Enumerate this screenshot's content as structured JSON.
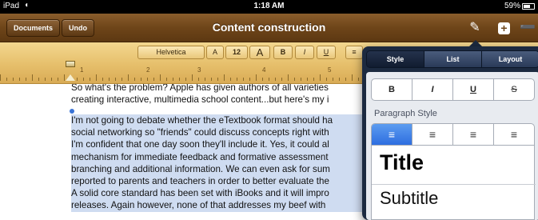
{
  "status_bar": {
    "device": "iPad",
    "time": "1:18 AM",
    "battery": "59%"
  },
  "toolbar": {
    "documents_label": "Documents",
    "undo_label": "Undo",
    "title": "Content construction"
  },
  "format_bar": {
    "font": "Helvetica",
    "smaller": "A",
    "size": "12",
    "larger": "A",
    "bold": "B",
    "italic": "I",
    "underline": "U",
    "align": "≡"
  },
  "ruler": {
    "numbers": [
      "1",
      "2",
      "3",
      "4",
      "5"
    ]
  },
  "document": {
    "para1": [
      "So what's the problem? Apple has given authors of all varieties",
      "creating interactive, multimedia school content...but here's my i"
    ],
    "para2": [
      "I'm not going to debate whether the eTextbook format should ha",
      "social networking so \"friends\" could discuss concepts right with",
      "I'm confident that one day soon they'll include it. Yes, it could al",
      "mechanism for immediate feedback and formative assessment",
      "branching and additional information. We can even ask for sum",
      "reported to parents and teachers in order to better evaluate the",
      "A solid core standard has been set with iBooks and it will impro",
      "releases. Again however, none of that addresses my beef with"
    ]
  },
  "popover": {
    "tabs": [
      "Style",
      "List",
      "Layout"
    ],
    "active_tab": "Style",
    "text_styles": [
      "B",
      "I",
      "U",
      "S"
    ],
    "paragraph_style_label": "Paragraph Style",
    "alignments": [
      "align-left",
      "align-center",
      "align-right",
      "justify"
    ],
    "styles": [
      "Title",
      "Subtitle"
    ]
  },
  "colors": {
    "selection": "#cfdcf1",
    "wood": "#6e4519",
    "popover": "#1c2a40",
    "active_align": "#2e6ee0"
  }
}
